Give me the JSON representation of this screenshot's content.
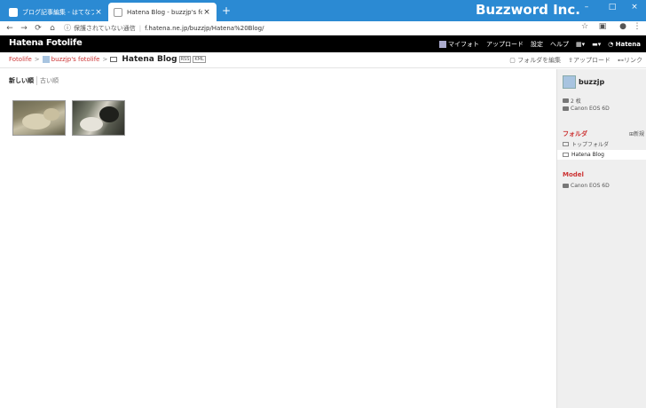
{
  "browser": {
    "tabs": [
      {
        "label": "ブログ記事編集 - はてなブログ",
        "active": false
      },
      {
        "label": "Hatena Blog - buzzjp's fotolife",
        "active": true
      }
    ],
    "new_tab_symbol": "+",
    "close_symbol": "×",
    "brand_overlay": "Buzzword Inc.",
    "window_controls": {
      "minimize": "–",
      "maximize": "□",
      "close": "×"
    },
    "security_label": "保護されていない通信",
    "url": "f.hatena.ne.jp/buzzjp/Hatena%20Blog/",
    "icons": [
      "back-icon",
      "forward-icon",
      "reload-icon",
      "home-icon",
      "info-icon",
      "star-icon",
      "extension-icon",
      "profile-icon",
      "menu-icon"
    ]
  },
  "header": {
    "logo": "Hatena Fotolife",
    "nav": {
      "myfoto": "マイフォト",
      "upload": "アップロード",
      "settings": "設定",
      "help": "ヘルプ",
      "hatena": "Hatena"
    }
  },
  "breadcrumb": {
    "root": "Fotolife",
    "user": "buzzjp's fotolife",
    "current": "Hatena Blog",
    "badges": [
      "RSS",
      "KML"
    ],
    "actions": {
      "edit_folder": "フォルダを編集",
      "upload": "アップロード",
      "link": "リンク"
    }
  },
  "sort": {
    "newest": "新しい順",
    "oldest": "古い順"
  },
  "photos": [
    {
      "name": "photo-thumbnail-sheep"
    },
    {
      "name": "photo-thumbnail-goat"
    }
  ],
  "sidebar": {
    "username": "buzzjp",
    "photo_count": "2 枚",
    "camera": "Canon EOS 6D",
    "folders_heading": "フォルダ",
    "new_folder": "新規",
    "folders": [
      {
        "label": "トップフォルダ",
        "active": false
      },
      {
        "label": "Hatena Blog",
        "active": true
      }
    ],
    "model_heading": "Model",
    "models": [
      "Canon EOS 6D"
    ]
  },
  "colors": {
    "titlebar": "#2b8ad3",
    "header": "#000000",
    "accent_red": "#cc3333",
    "sidebar_bg": "#efefef"
  }
}
